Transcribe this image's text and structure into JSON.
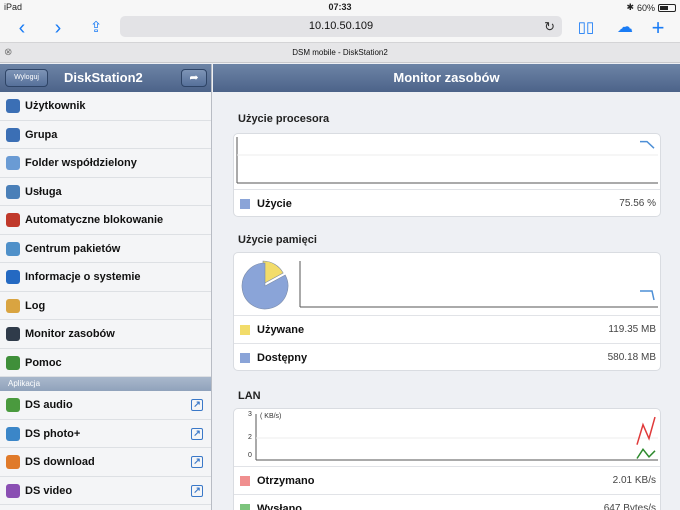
{
  "statusbar": {
    "device": "iPad",
    "time": "07:33",
    "battery": "60%",
    "battery_level": 0.6
  },
  "browser": {
    "url": "10.10.50.109",
    "tab_title": "DSM mobile - DiskStation2"
  },
  "sidebar": {
    "logout_label": "Wyloguj",
    "title": "DiskStation2",
    "items": [
      {
        "label": "Użytkownik",
        "icon": "user-icon",
        "color": "#3b6fb5"
      },
      {
        "label": "Grupa",
        "icon": "group-icon",
        "color": "#3b6fb5"
      },
      {
        "label": "Folder współdzielony",
        "icon": "shared-folder-icon",
        "color": "#6a9bd4"
      },
      {
        "label": "Usługa",
        "icon": "service-icon",
        "color": "#4a7fb8"
      },
      {
        "label": "Automatyczne blokowanie",
        "icon": "auto-block-icon",
        "color": "#c0392b"
      },
      {
        "label": "Centrum pakietów",
        "icon": "package-center-icon",
        "color": "#4f90c9"
      },
      {
        "label": "Informacje o systemie",
        "icon": "info-icon",
        "color": "#2469c2"
      },
      {
        "label": "Log",
        "icon": "log-icon",
        "color": "#d9a441"
      },
      {
        "label": "Monitor zasobów",
        "icon": "resource-monitor-icon",
        "color": "#2f3b4a"
      },
      {
        "label": "Pomoc",
        "icon": "help-icon",
        "color": "#3f8f3a"
      }
    ],
    "section_label": "Aplikacja",
    "apps": [
      {
        "label": "DS audio",
        "icon": "ds-audio-icon",
        "color": "#4a9a3e"
      },
      {
        "label": "DS photo+",
        "icon": "ds-photo-icon",
        "color": "#3b86c8"
      },
      {
        "label": "DS download",
        "icon": "ds-download-icon",
        "color": "#e07a2a"
      },
      {
        "label": "DS video",
        "icon": "ds-video-icon",
        "color": "#8a4fb3"
      }
    ]
  },
  "main": {
    "title": "Monitor zasobów",
    "cpu": {
      "title": "Użycie procesora",
      "rows": [
        {
          "name": "Użycie",
          "value": "75.56 %",
          "color": "#8aa4d8"
        }
      ]
    },
    "memory": {
      "title": "Użycie pamięci",
      "rows": [
        {
          "name": "Używane",
          "value": "119.35 MB",
          "color": "#f2dc6a"
        },
        {
          "name": "Dostępny",
          "value": "580.18 MB",
          "color": "#8aa4d8"
        }
      ]
    },
    "lan": {
      "title": "LAN",
      "unit": "( KB/s)",
      "ticks": [
        "3",
        "2",
        "0"
      ],
      "rows": [
        {
          "name": "Otrzymano",
          "value": "2.01 KB/s",
          "color": "#f08f8f"
        },
        {
          "name": "Wysłano",
          "value": "647 Bytes/s",
          "color": "#7cc47c"
        }
      ]
    }
  },
  "chart_data": [
    {
      "type": "line",
      "title": "Użycie procesora",
      "series": [
        {
          "name": "Użycie",
          "values": [
            90,
            90,
            75.56
          ]
        }
      ]
    },
    {
      "type": "pie",
      "title": "Użycie pamięci",
      "categories": [
        "Używane",
        "Dostępny"
      ],
      "values": [
        119.35,
        580.18
      ]
    },
    {
      "type": "line",
      "title": "LAN",
      "ylabel": "( KB/s)",
      "yticks": [
        0,
        2,
        3
      ],
      "ylim": [
        0,
        3
      ],
      "series": [
        {
          "name": "Otrzymano",
          "values": [
            1.0,
            2.3,
            1.4,
            2.8
          ]
        },
        {
          "name": "Wysłano",
          "values": [
            0.1,
            0.7,
            0.2,
            0.6
          ]
        }
      ]
    }
  ]
}
